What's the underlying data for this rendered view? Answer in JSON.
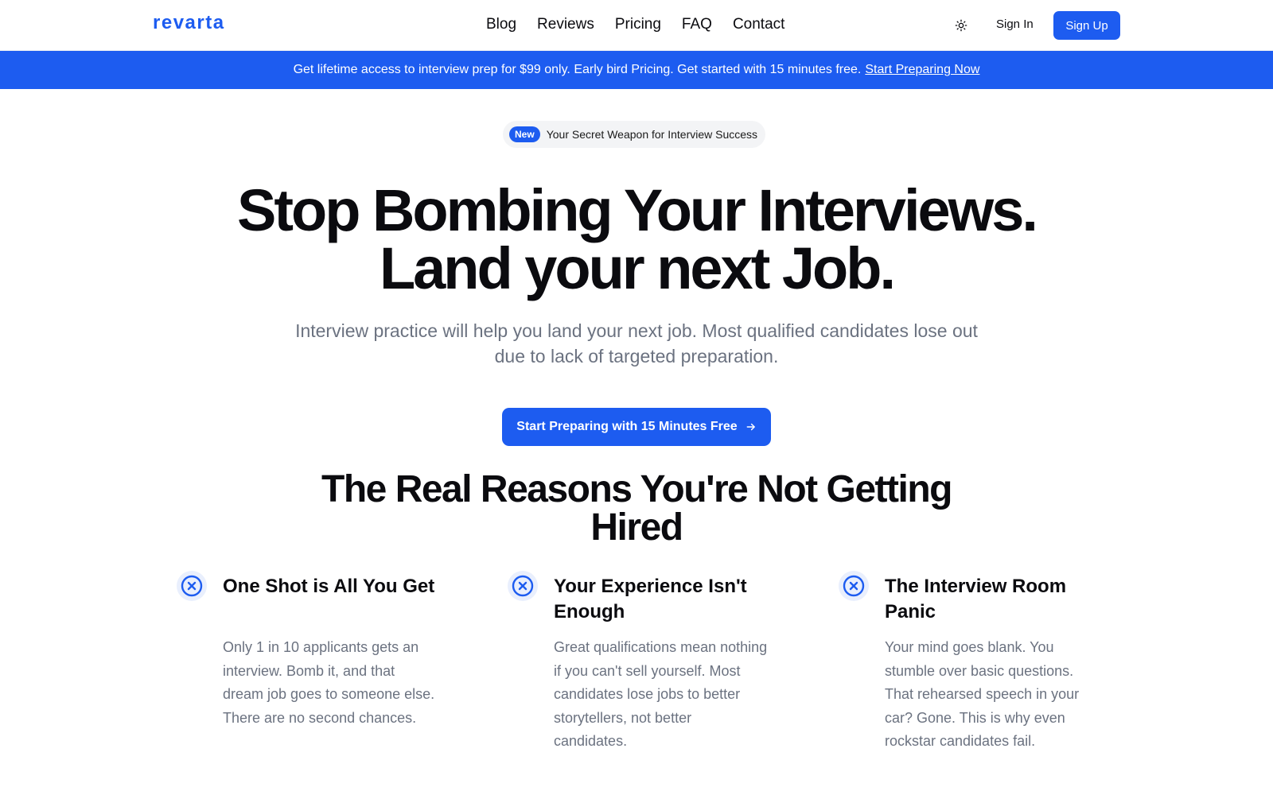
{
  "nav": {
    "logo": "revarta",
    "links": [
      "Blog",
      "Reviews",
      "Pricing",
      "FAQ",
      "Contact"
    ],
    "theme_icon": "sun-icon",
    "sign_in": "Sign In",
    "sign_up": "Sign Up"
  },
  "banner": {
    "text": "Get lifetime access to interview prep for $99 only. Early bird Pricing. Get started with 15 minutes free.",
    "link": "Start Preparing Now"
  },
  "hero": {
    "badge": "New",
    "badge_text": "Your Secret Weapon for Interview Success",
    "title_line1": "Stop Bombing Your Interviews.",
    "title_line2": "Land your next Job.",
    "subtitle": "Interview practice will help you land your next job. Most qualified candidates lose out due to lack of targeted preparation.",
    "cta": "Start Preparing with 15 Minutes Free",
    "cta_icon": "arrow-right-icon"
  },
  "reasons": {
    "heading": "The Real Reasons You're Not Getting Hired",
    "items": [
      {
        "icon": "x-circle-icon",
        "title": "One Shot is All You Get",
        "desc": "Only 1 in 10 applicants gets an interview. Bomb it, and that dream job goes to someone else. There are no second chances."
      },
      {
        "icon": "x-circle-icon",
        "title": "Your Experience Isn't Enough",
        "desc": "Great qualifications mean nothing if you can't sell yourself. Most candidates lose jobs to better storytellers, not better candidates."
      },
      {
        "icon": "x-circle-icon",
        "title": "The Interview Room Panic",
        "desc": "Your mind goes blank. You stumble over basic questions. That rehearsed speech in your car? Gone. This is why even rockstar candidates fail."
      }
    ]
  },
  "colors": {
    "accent": "#1d5cf0",
    "text": "#0b0b0f",
    "muted": "#6b7280"
  }
}
